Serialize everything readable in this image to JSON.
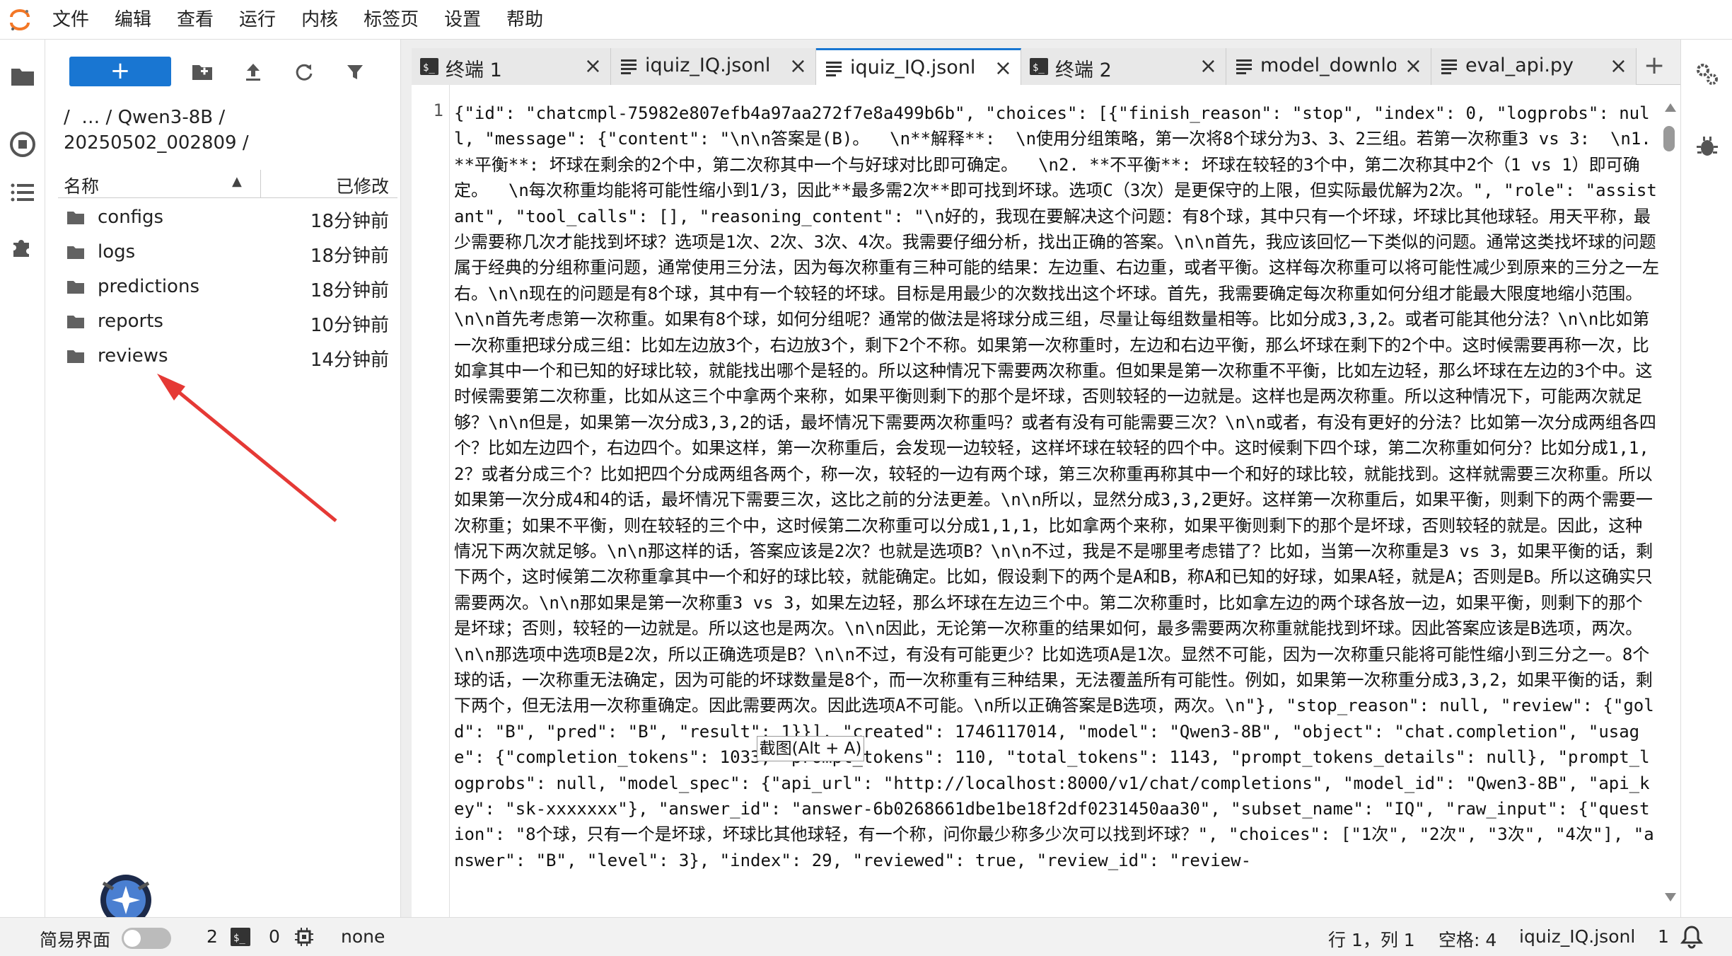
{
  "menu": [
    "文件",
    "编辑",
    "查看",
    "运行",
    "内核",
    "标签页",
    "设置",
    "帮助"
  ],
  "filebrowser": {
    "new_button": "+",
    "breadcrumb": "/  … / Qwen3-8B / 20250502_002809 /",
    "header_name": "名称",
    "header_modified": "已修改",
    "files": [
      {
        "name": "configs",
        "modified": "18分钟前"
      },
      {
        "name": "logs",
        "modified": "18分钟前"
      },
      {
        "name": "predictions",
        "modified": "18分钟前"
      },
      {
        "name": "reports",
        "modified": "10分钟前"
      },
      {
        "name": "reviews",
        "modified": "14分钟前"
      }
    ]
  },
  "tabs": [
    {
      "label": "终端 1",
      "icon": "terminal-icon"
    },
    {
      "label": "iquiz_IQ.jsonl",
      "icon": "text-file-icon"
    },
    {
      "label": "iquiz_IQ.jsonl",
      "icon": "text-file-icon",
      "active": true
    },
    {
      "label": "终端 2",
      "icon": "terminal-icon"
    },
    {
      "label": "model_downlo",
      "icon": "text-file-icon"
    },
    {
      "label": "eval_api.py",
      "icon": "text-file-icon"
    }
  ],
  "editor": {
    "line_number": "1",
    "content": "{\"id\": \"chatcmpl-75982e807efb4a97aa272f7e8a499b6b\", \"choices\": [{\"finish_reason\": \"stop\", \"index\": 0, \"logprobs\": null, \"message\": {\"content\": \"\\n\\n答案是(B)。  \\n**解释**:  \\n使用分组策略，第一次将8个球分为3、3、2三组。若第一次称重3 vs 3:  \\n1. **平衡**: 坏球在剩余的2个中，第二次称其中一个与好球对比即可确定。  \\n2. **不平衡**: 坏球在较轻的3个中，第二次称其中2个（1 vs 1）即可确定。  \\n每次称重均能将可能性缩小到1/3，因此**最多需2次**即可找到坏球。选项C（3次）是更保守的上限，但实际最优解为2次。\", \"role\": \"assistant\", \"tool_calls\": [], \"reasoning_content\": \"\\n好的，我现在要解决这个问题：有8个球，其中只有一个坏球，坏球比其他球轻。用天平称，最少需要称几次才能找到坏球？选项是1次、2次、3次、4次。我需要仔细分析，找出正确的答案。\\n\\n首先，我应该回忆一下类似的问题。通常这类找坏球的问题属于经典的分组称重问题，通常使用三分法，因为每次称重有三种可能的结果：左边重、右边重，或者平衡。这样每次称重可以将可能性减少到原来的三分之一左右。\\n\\n现在的问题是有8个球，其中有一个较轻的坏球。目标是用最少的次数找出这个坏球。首先，我需要确定每次称重如何分组才能最大限度地缩小范围。\\n\\n首先考虑第一次称重。如果有8个球，如何分组呢？通常的做法是将球分成三组，尽量让每组数量相等。比如分成3,3,2。或者可能其他分法？\\n\\n比如第一次称重把球分成三组：比如左边放3个，右边放3个，剩下2个不称。如果第一次称重时，左边和右边平衡，那么坏球在剩下的2个中。这时候需要再称一次，比如拿其中一个和已知的好球比较，就能找出哪个是轻的。所以这种情况下需要两次称重。但如果是第一次称重不平衡，比如左边轻，那么坏球在左边的3个中。这时候需要第二次称重，比如从这三个中拿两个来称，如果平衡则剩下的那个是坏球，否则较轻的一边就是。这样也是两次称重。所以这种情况下，可能两次就足够？\\n\\n但是，如果第一次分成3,3,2的话，最坏情况下需要两次称重吗？或者有没有可能需要三次？\\n\\n或者，有没有更好的分法？比如第一次分成两组各四个？比如左边四个，右边四个。如果这样，第一次称重后，会发现一边较轻，这样坏球在较轻的四个中。这时候剩下四个球，第二次称重如何分？比如分成1,1,2？或者分成三个？比如把四个分成两组各两个，称一次，较轻的一边有两个球，第三次称重再称其中一个和好的球比较，就能找到。这样就需要三次称重。所以如果第一次分成4和4的话，最坏情况下需要三次，这比之前的分法更差。\\n\\n所以，显然分成3,3,2更好。这样第一次称重后，如果平衡，则剩下的两个需要一次称重；如果不平衡，则在较轻的三个中，这时候第二次称重可以分成1,1,1，比如拿两个来称，如果平衡则剩下的那个是坏球，否则较轻的就是。因此，这种情况下两次就足够。\\n\\n那这样的话，答案应该是2次？也就是选项B？\\n\\n不过，我是不是哪里考虑错了？比如，当第一次称重是3 vs 3，如果平衡的话，剩下两个，这时候第二次称重拿其中一个和好的球比较，就能确定。比如，假设剩下的两个是A和B，称A和已知的好球，如果A轻，就是A；否则是B。所以这确实只需要两次。\\n\\n那如果是第一次称重3 vs 3，如果左边轻，那么坏球在左边三个中。第二次称重时，比如拿左边的两个球各放一边，如果平衡，则剩下的那个是坏球；否则，较轻的一边就是。所以这也是两次。\\n\\n因此，无论第一次称重的结果如何，最多需要两次称重就能找到坏球。因此答案应该是B选项，两次。\\n\\n那选项中选项B是2次，所以正确选项是B？\\n\\n不过，有没有可能更少？比如选项A是1次。显然不可能，因为一次称重只能将可能性缩小到三分之一。8个球的话，一次称重无法确定，因为可能的坏球数量是8个，而一次称重有三种结果，无法覆盖所有可能性。例如，如果第一次称重分成3,3,2，如果平衡的话，剩下两个，但无法用一次称重确定。因此需要两次。因此选项A不可能。\\n所以正确答案是B选项，两次。\\n\"}, \"stop_reason\": null, \"review\": {\"gold\": \"B\", \"pred\": \"B\", \"result\": 1}}], \"created\": 1746117014, \"model\": \"Qwen3-8B\", \"object\": \"chat.completion\", \"usage\": {\"completion_tokens\": 1033, \"prompt_tokens\": 110, \"total_tokens\": 1143, \"prompt_tokens_details\": null}, \"prompt_logprobs\": null, \"model_spec\": {\"api_url\": \"http://localhost:8000/v1/chat/completions\", \"model_id\": \"Qwen3-8B\", \"api_key\": \"sk-xxxxxxx\"}, \"answer_id\": \"answer-6b0268661dbe1be18f2df0231450aa30\", \"subset_name\": \"IQ\", \"raw_input\": {\"question\": \"8个球，只有一个是坏球，坏球比其他球轻，有一个称，问你最少称多少次可以找到坏球？\", \"choices\": [\"1次\", \"2次\", \"3次\", \"4次\"], \"answer\": \"B\", \"level\": 3}, \"index\": 29, \"reviewed\": true, \"review_id\": \"review-"
  },
  "tooltip": "截图(Alt + A)",
  "statusbar": {
    "simple_mode_label": "简易界面",
    "terminals_count": "2",
    "kernels_count": "0",
    "kernel_name": "none",
    "cursor_position": "行 1，列 1",
    "indent": "空格: 4",
    "file_name": "iquiz_IQ.jsonl",
    "notifications": "1"
  },
  "colors": {
    "accent": "#1976d2",
    "annotation_arrow": "#e53935"
  }
}
